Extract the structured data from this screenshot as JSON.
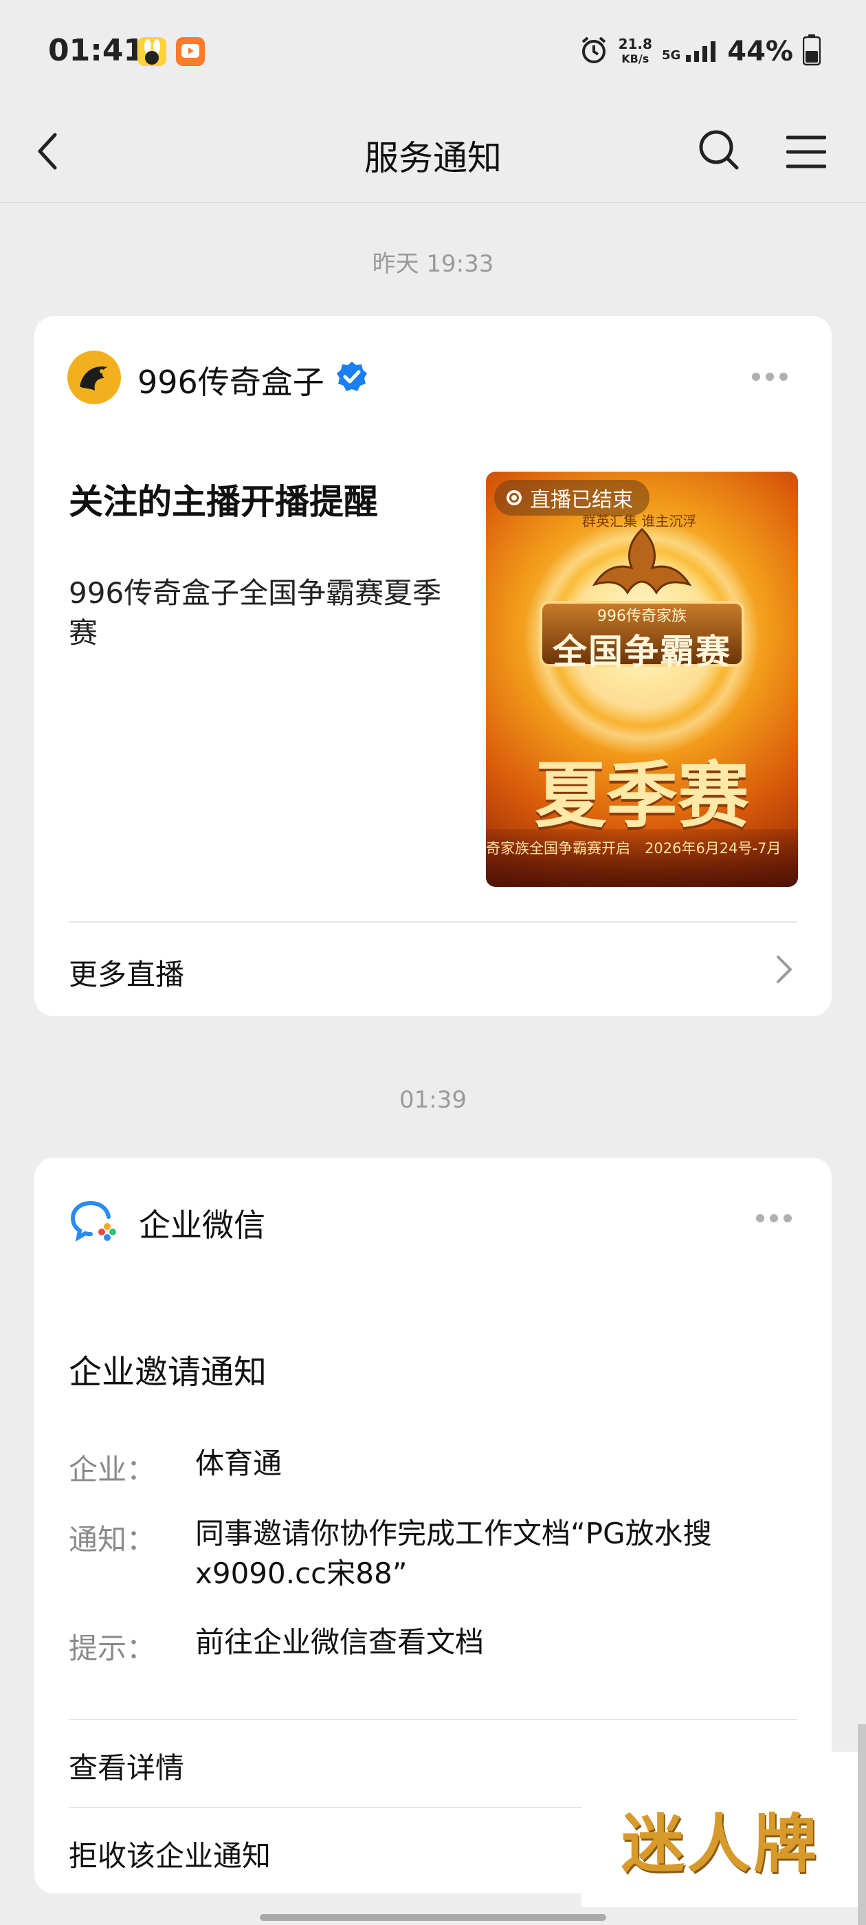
{
  "status_bar": {
    "time": "01:41",
    "net_speed_value": "21.8",
    "net_speed_unit": "KB/s",
    "network": "5G",
    "battery": "44%"
  },
  "nav": {
    "title": "服务通知",
    "back_icon": "chevron-left-icon",
    "search_icon": "search-icon",
    "menu_icon": "menu-icon"
  },
  "messages": [
    {
      "timestamp": "昨天 19:33",
      "account": "996传奇盒子",
      "verified": true,
      "title": "关注的主播开播提醒",
      "description": "996传奇盒子全国争霸赛夏季赛",
      "thumbnail": {
        "status": "直播已结束",
        "top_caption": "群英汇集 谁主沉浮",
        "brand": "996传奇家族",
        "headline": "全国争霸赛",
        "big_text": "夏季赛",
        "footer_text": "奇家族全国争霸赛开启　2026年6月24号-7月"
      },
      "action_label": "更多直播"
    },
    {
      "timestamp": "01:39",
      "account": "企业微信",
      "title": "企业邀请通知",
      "fields": [
        {
          "label": "企业：",
          "value": "体育通"
        },
        {
          "label": "通知：",
          "value": "同事邀请你协作完成工作文档“PG放水搜x9090.cc宋88”"
        },
        {
          "label": "提示：",
          "value": "前往企业微信查看文档"
        }
      ],
      "actions": [
        "查看详情",
        "拒收该企业通知"
      ]
    }
  ],
  "watermark_text": "迷人牌",
  "colors": {
    "background": "#ededed",
    "card": "#ffffff",
    "verified_blue": "#1a7ff0",
    "wecom_blue": "#2b8cf0"
  }
}
